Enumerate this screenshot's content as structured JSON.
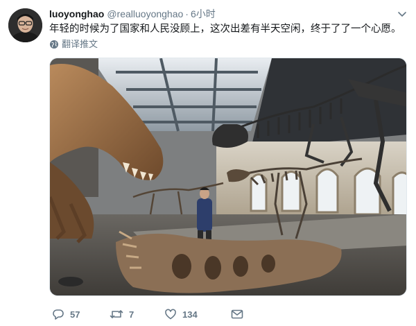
{
  "tweet": {
    "display_name": "luoyonghao",
    "handle": "@realluoyonghao",
    "separator": "·",
    "time": "6小时",
    "text": "年轻的时候为了国家和人民没顾上，这次出差有半天空闲，终于了了一个心愿。",
    "translate_label": "翻译推文"
  },
  "actions": {
    "reply_count": "57",
    "retweet_count": "7",
    "like_count": "134"
  },
  "icons": {
    "reply": "reply-icon",
    "retweet": "retweet-icon",
    "like": "heart-icon",
    "mail": "mail-icon",
    "translate": "globe-icon",
    "menu": "chevron-down-icon"
  },
  "colors": {
    "text": "#14171a",
    "secondary": "#657786"
  }
}
